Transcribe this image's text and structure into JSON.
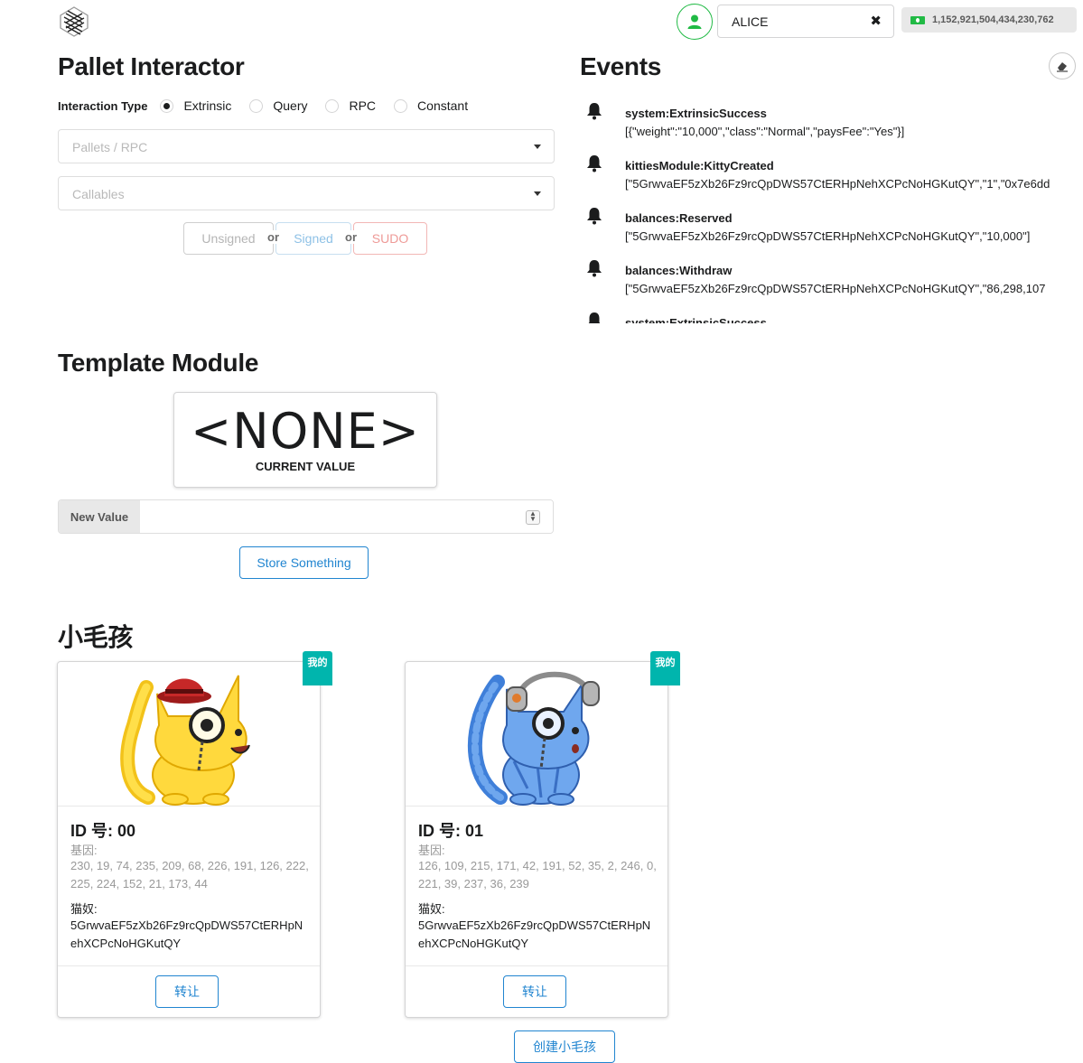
{
  "topbar": {
    "account_name": "ALICE",
    "balance": "1,152,921,504,434,230,762"
  },
  "pallet": {
    "title": "Pallet Interactor",
    "interaction_label": "Interaction Type",
    "options": [
      "Extrinsic",
      "Query",
      "RPC",
      "Constant"
    ],
    "selected": "Extrinsic",
    "pallets_placeholder": "Pallets / RPC",
    "callables_placeholder": "Callables",
    "unsigned_label": "Unsigned",
    "signed_label": "Signed",
    "sudo_label": "SUDO",
    "or_label": "or"
  },
  "events": {
    "title": "Events",
    "items": [
      {
        "name": "system:ExtrinsicSuccess",
        "data": "[{\"weight\":\"10,000\",\"class\":\"Normal\",\"paysFee\":\"Yes\"}]"
      },
      {
        "name": "kittiesModule:KittyCreated",
        "data": "[\"5GrwvaEF5zXb26Fz9rcQpDWS57CtERHpNehXCPcNoHGKutQY\",\"1\",\"0x7e6dd"
      },
      {
        "name": "balances:Reserved",
        "data": "[\"5GrwvaEF5zXb26Fz9rcQpDWS57CtERHpNehXCPcNoHGKutQY\",\"10,000\"]"
      },
      {
        "name": "balances:Withdraw",
        "data": "[\"5GrwvaEF5zXb26Fz9rcQpDWS57CtERHpNehXCPcNoHGKutQY\",\"86,298,107"
      },
      {
        "name": "system:ExtrinsicSuccess",
        "data": ""
      }
    ]
  },
  "template": {
    "title": "Template Module",
    "current_value": "<NONE>",
    "current_label": "CURRENT VALUE",
    "new_value_label": "New Value",
    "store_label": "Store Something"
  },
  "kitties": {
    "title": "小毛孩",
    "mine_badge": "我的",
    "id_prefix": "ID 号:",
    "genes_label": "基因:",
    "owner_label": "猫奴:",
    "transfer_label": "转让",
    "create_label": "创建小毛孩",
    "items": [
      {
        "id": "00",
        "genes": "230, 19, 74, 235, 209, 68, 226, 191, 126, 222, 225, 224, 152, 21, 173, 44",
        "owner": "5GrwvaEF5zXb26Fz9rcQpDWS57CtERHpNehXCPcNoHGKutQY"
      },
      {
        "id": "01",
        "genes": "126, 109, 215, 171, 42, 191, 52, 35, 2, 246, 0, 221, 39, 237, 36, 239",
        "owner": "5GrwvaEF5zXb26Fz9rcQpDWS57CtERHpNehXCPcNoHGKutQY"
      }
    ]
  },
  "colors": {
    "primary": "#2185d0",
    "teal": "#00b5ad",
    "green": "#21ba45",
    "sudo_red": "#ee9a97"
  }
}
